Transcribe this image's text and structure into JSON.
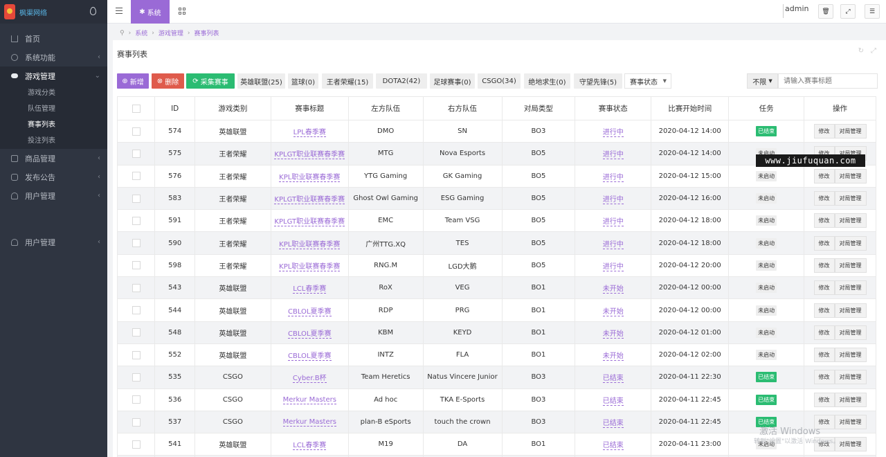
{
  "sidebar": {
    "logo_text": "枫渠网络",
    "menu": [
      {
        "label": "首页",
        "icon": "home-icon"
      },
      {
        "label": "系统功能",
        "icon": "gear-icon"
      },
      {
        "label": "游戏管理",
        "icon": "gamepad-icon"
      },
      {
        "label": "商品管理",
        "icon": "bag-icon"
      },
      {
        "label": "发布公告",
        "icon": "bell-icon"
      },
      {
        "label": "用户管理",
        "icon": "users-icon"
      },
      {
        "label": "用户管理",
        "icon": "users-icon"
      }
    ],
    "submenu": [
      "游戏分类",
      "队伍管理",
      "赛事列表",
      "投注列表"
    ]
  },
  "topbar": {
    "tab_label": "系统",
    "avatar_alt": "admin"
  },
  "breadcrumb": [
    "系统",
    "游戏管理",
    "赛事列表"
  ],
  "panel": {
    "title": "赛事列表"
  },
  "toolbar": {
    "new_label": "新增",
    "delete_label": "删除",
    "collect_label": "采集赛事",
    "categories": [
      "英雄联盟(25)",
      "篮球(0)",
      "王者荣耀(15)",
      "DOTA2(42)",
      "足球赛事(0)",
      "CSGO(34)",
      "绝地求生(0)",
      "守望先锋(5)"
    ],
    "status_select": "赛事状态",
    "limit_label": "不限",
    "search_placeholder": "请输入赛事标题"
  },
  "table": {
    "headers": [
      "ID",
      "游戏类别",
      "赛事标题",
      "左方队伍",
      "右方队伍",
      "对局类型",
      "赛事状态",
      "比赛开始时间",
      "任务",
      "操作"
    ],
    "edit_label": "修改",
    "manage_label": "对局管理",
    "rows": [
      {
        "id": "574",
        "game": "英雄联盟",
        "title": "LPL春季赛",
        "left": "DMO",
        "right": "SN",
        "type": "BO3",
        "status": "进行中",
        "time": "2020-04-12 14:00",
        "task": "已结束",
        "task_done": true
      },
      {
        "id": "575",
        "game": "王者荣耀",
        "title": "KPLGT职业联赛春季赛",
        "left": "MTG",
        "right": "Nova Esports",
        "type": "BO5",
        "status": "进行中",
        "time": "2020-04-12 14:00",
        "task": "未启动",
        "task_done": false
      },
      {
        "id": "576",
        "game": "王者荣耀",
        "title": "KPL职业联赛春季赛",
        "left": "YTG Gaming",
        "right": "GK Gaming",
        "type": "BO5",
        "status": "进行中",
        "time": "2020-04-12 15:00",
        "task": "未启动",
        "task_done": false
      },
      {
        "id": "583",
        "game": "王者荣耀",
        "title": "KPLGT职业联赛春季赛",
        "left": "Ghost Owl Gaming",
        "right": "ESG Gaming",
        "type": "BO5",
        "status": "进行中",
        "time": "2020-04-12 16:00",
        "task": "未启动",
        "task_done": false
      },
      {
        "id": "591",
        "game": "王者荣耀",
        "title": "KPLGT职业联赛春季赛",
        "left": "EMC",
        "right": "Team VSG",
        "type": "BO5",
        "status": "进行中",
        "time": "2020-04-12 18:00",
        "task": "未启动",
        "task_done": false
      },
      {
        "id": "590",
        "game": "王者荣耀",
        "title": "KPL职业联赛春季赛",
        "left": "广州TTG.XQ",
        "right": "TES",
        "type": "BO5",
        "status": "进行中",
        "time": "2020-04-12 18:00",
        "task": "未启动",
        "task_done": false
      },
      {
        "id": "598",
        "game": "王者荣耀",
        "title": "KPL职业联赛春季赛",
        "left": "RNG.M",
        "right": "LGD大鹅",
        "type": "BO5",
        "status": "进行中",
        "time": "2020-04-12 20:00",
        "task": "未启动",
        "task_done": false
      },
      {
        "id": "543",
        "game": "英雄联盟",
        "title": "LCL春季赛",
        "left": "RoX",
        "right": "VEG",
        "type": "BO1",
        "status": "未开始",
        "time": "2020-04-12 00:00",
        "task": "未启动",
        "task_done": false
      },
      {
        "id": "544",
        "game": "英雄联盟",
        "title": "CBLOL夏季赛",
        "left": "RDP",
        "right": "PRG",
        "type": "BO1",
        "status": "未开始",
        "time": "2020-04-12 00:00",
        "task": "未启动",
        "task_done": false
      },
      {
        "id": "548",
        "game": "英雄联盟",
        "title": "CBLOL夏季赛",
        "left": "KBM",
        "right": "KEYD",
        "type": "BO1",
        "status": "未开始",
        "time": "2020-04-12 01:00",
        "task": "未启动",
        "task_done": false
      },
      {
        "id": "552",
        "game": "英雄联盟",
        "title": "CBLOL夏季赛",
        "left": "INTZ",
        "right": "FLA",
        "type": "BO1",
        "status": "未开始",
        "time": "2020-04-12 02:00",
        "task": "未启动",
        "task_done": false
      },
      {
        "id": "535",
        "game": "CSGO",
        "title": "Cyber.B杯",
        "left": "Team Heretics",
        "right": "Natus Vincere Junior",
        "type": "BO3",
        "status": "已结束",
        "time": "2020-04-11 22:30",
        "task": "已结束",
        "task_done": true
      },
      {
        "id": "536",
        "game": "CSGO",
        "title": "Merkur Masters",
        "left": "Ad hoc",
        "right": "TKA E-Sports",
        "type": "BO3",
        "status": "已结束",
        "time": "2020-04-11 22:45",
        "task": "已结束",
        "task_done": true
      },
      {
        "id": "537",
        "game": "CSGO",
        "title": "Merkur Masters",
        "left": "plan-B eSports",
        "right": "touch the crown",
        "type": "BO3",
        "status": "已结束",
        "time": "2020-04-11 22:45",
        "task": "已结束",
        "task_done": true
      },
      {
        "id": "541",
        "game": "英雄联盟",
        "title": "LCL春季赛",
        "left": "M19",
        "right": "DA",
        "type": "BO1",
        "status": "已结束",
        "time": "2020-04-11 23:00",
        "task": "未启动",
        "task_done": false
      }
    ]
  },
  "overlay": {
    "watermark": "www.jiufuquan.com",
    "activate_title": "激活 Windows",
    "activate_hint": "转到\"设置\"以激活 Windows。"
  },
  "colors": {
    "accent": "#9a6ad6",
    "sidebar_bg": "#2f3541",
    "danger": "#df5b4c",
    "success": "#2bbc72"
  }
}
